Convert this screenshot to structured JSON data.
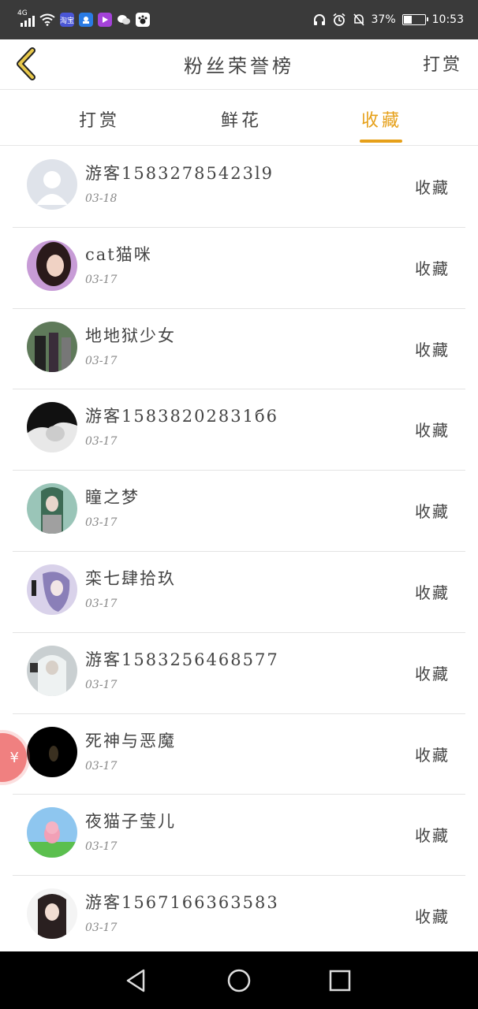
{
  "status_bar": {
    "network": "4G",
    "app_icon_labels": [
      "淘宝",
      "",
      "",
      "",
      ""
    ],
    "battery_percent": "37%",
    "battery_level": 0.37,
    "time": "10:53"
  },
  "header": {
    "title": "粉丝荣誉榜",
    "right_action": "打赏"
  },
  "tabs": [
    {
      "label": "打赏",
      "active": false
    },
    {
      "label": "鲜花",
      "active": false
    },
    {
      "label": "收藏",
      "active": true
    }
  ],
  "list": [
    {
      "name": "游客15832785423l9",
      "date": "03-18",
      "action": "收藏"
    },
    {
      "name": "cat猫咪",
      "date": "03-17",
      "action": "收藏"
    },
    {
      "name": "地地狱少女",
      "date": "03-17",
      "action": "收藏"
    },
    {
      "name": "游客15838202831б6",
      "date": "03-17",
      "action": "收藏"
    },
    {
      "name": "瞳之梦",
      "date": "03-17",
      "action": "收藏"
    },
    {
      "name": "栾七肆拾玖",
      "date": "03-17",
      "action": "收藏"
    },
    {
      "name": "游客1583256468577",
      "date": "03-17",
      "action": "收藏"
    },
    {
      "name": "死神与恶魔",
      "date": "03-17",
      "action": "收藏"
    },
    {
      "name": "夜猫子莹儿",
      "date": "03-17",
      "action": "收藏"
    },
    {
      "name": "游客1567166363583",
      "date": "03-17",
      "action": "收藏"
    }
  ],
  "float_button": {
    "symbol": "¥"
  },
  "colors": {
    "accent": "#e6a019",
    "status_bar": "#3a3a3a",
    "divider": "#e3e3e3"
  },
  "icons": [
    "back-chevron-icon",
    "wifi-icon",
    "headphones-icon",
    "alarm-icon",
    "mute-bell-icon",
    "battery-icon",
    "nav-back-icon",
    "nav-home-icon",
    "nav-recents-icon"
  ]
}
